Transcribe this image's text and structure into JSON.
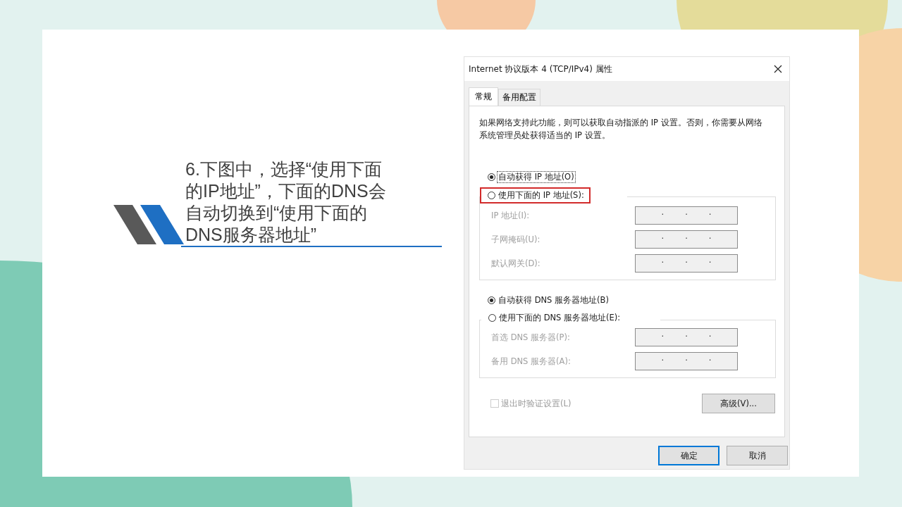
{
  "slide": {
    "caption_lines": [
      "6.下图中，选择“使用下面",
      "的IP地址”，下面的DNS会",
      "自动切换到“使用下面的",
      "DNS服务器地址”"
    ]
  },
  "dialog": {
    "title": "Internet 协议版本 4 (TCP/IPv4) 属性",
    "tabs": [
      {
        "label": "常规",
        "selected": true
      },
      {
        "label": "备用配置",
        "selected": false
      }
    ],
    "description": "如果网络支持此功能，则可以获取自动指派的 IP 设置。否则，你需要从网络系统管理员处获得适当的 IP 设置。",
    "ip_options": [
      {
        "label": "自动获得 IP 地址(O)",
        "selected": true,
        "focused": true,
        "highlighted": false
      },
      {
        "label": "使用下面的 IP 地址(S):",
        "selected": false,
        "focused": false,
        "highlighted": true
      }
    ],
    "ip_fields": [
      {
        "label": "IP 地址(I):",
        "disabled": true,
        "dots": [
          ".",
          ".",
          "."
        ]
      },
      {
        "label": "子网掩码(U):",
        "disabled": true,
        "dots": [
          ".",
          ".",
          "."
        ]
      },
      {
        "label": "默认网关(D):",
        "disabled": true,
        "dots": [
          ".",
          ".",
          "."
        ]
      }
    ],
    "dns_options": [
      {
        "label": "自动获得 DNS 服务器地址(B)",
        "selected": true,
        "focused": false,
        "highlighted": false
      },
      {
        "label": "使用下面的 DNS 服务器地址(E):",
        "selected": false,
        "focused": false,
        "highlighted": false
      }
    ],
    "dns_fields": [
      {
        "label": "首选 DNS 服务器(P):",
        "disabled": true,
        "dots": [
          ".",
          ".",
          "."
        ]
      },
      {
        "label": "备用 DNS 服务器(A):",
        "disabled": true,
        "dots": [
          ".",
          ".",
          "."
        ]
      }
    ],
    "validate_checkbox": {
      "label": "退出时验证设置(L)",
      "checked": false,
      "disabled": true
    },
    "advanced_button": "高级(V)...",
    "buttons": [
      "确定",
      "取消"
    ]
  }
}
